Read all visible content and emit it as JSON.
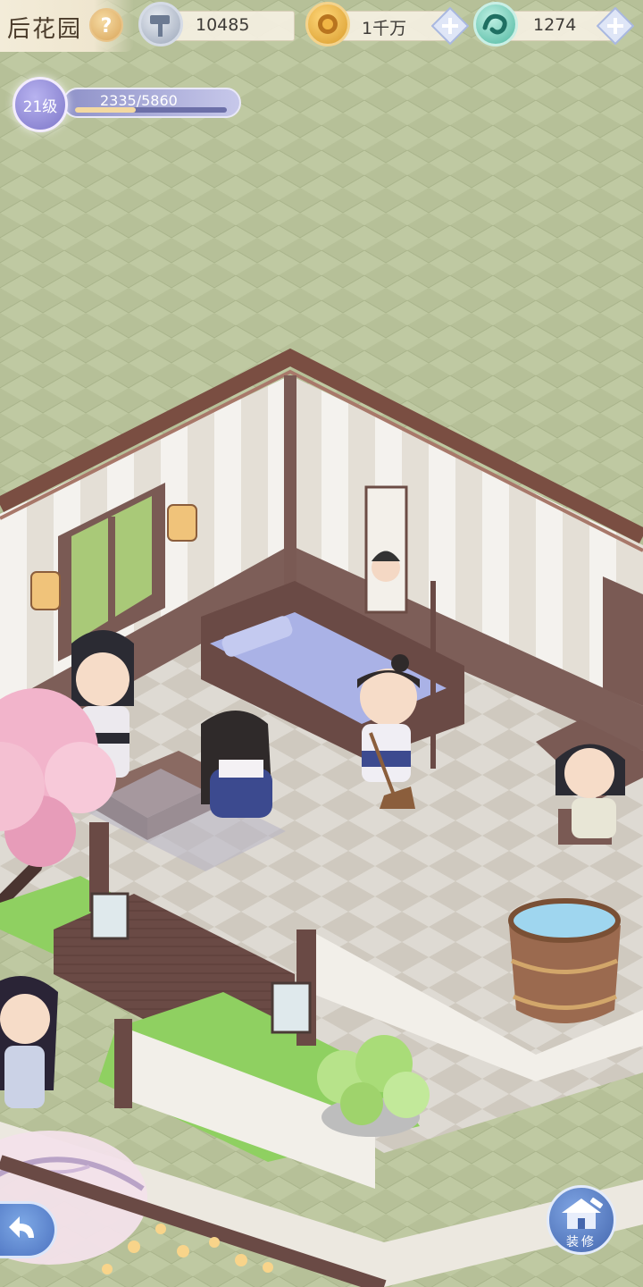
{
  "header": {
    "title": "后花园",
    "help_icon": "question-mark-icon"
  },
  "resources": [
    {
      "name": "hammer",
      "icon": "hammer-coin-icon",
      "value": "10485",
      "has_plus": false
    },
    {
      "name": "coins",
      "icon": "gold-coin-icon",
      "value": "1千万",
      "has_plus": true
    },
    {
      "name": "jade",
      "icon": "jade-dragon-icon",
      "value": "1274",
      "has_plus": true
    }
  ],
  "player": {
    "level_label": "21级",
    "exp_text": "2335/5860",
    "exp_fraction": 0.398
  },
  "buttons": {
    "back_icon": "back-arrow-icon",
    "build_label": "装修",
    "build_icon": "house-hammer-icon"
  },
  "colors": {
    "grass": "#b9c39a",
    "floor": "#dcd6cc",
    "wall": "#efece6",
    "roof_trim": "#7a4e42",
    "level_purple": "#8f92c9",
    "accent_blue": "#4c72c0"
  }
}
